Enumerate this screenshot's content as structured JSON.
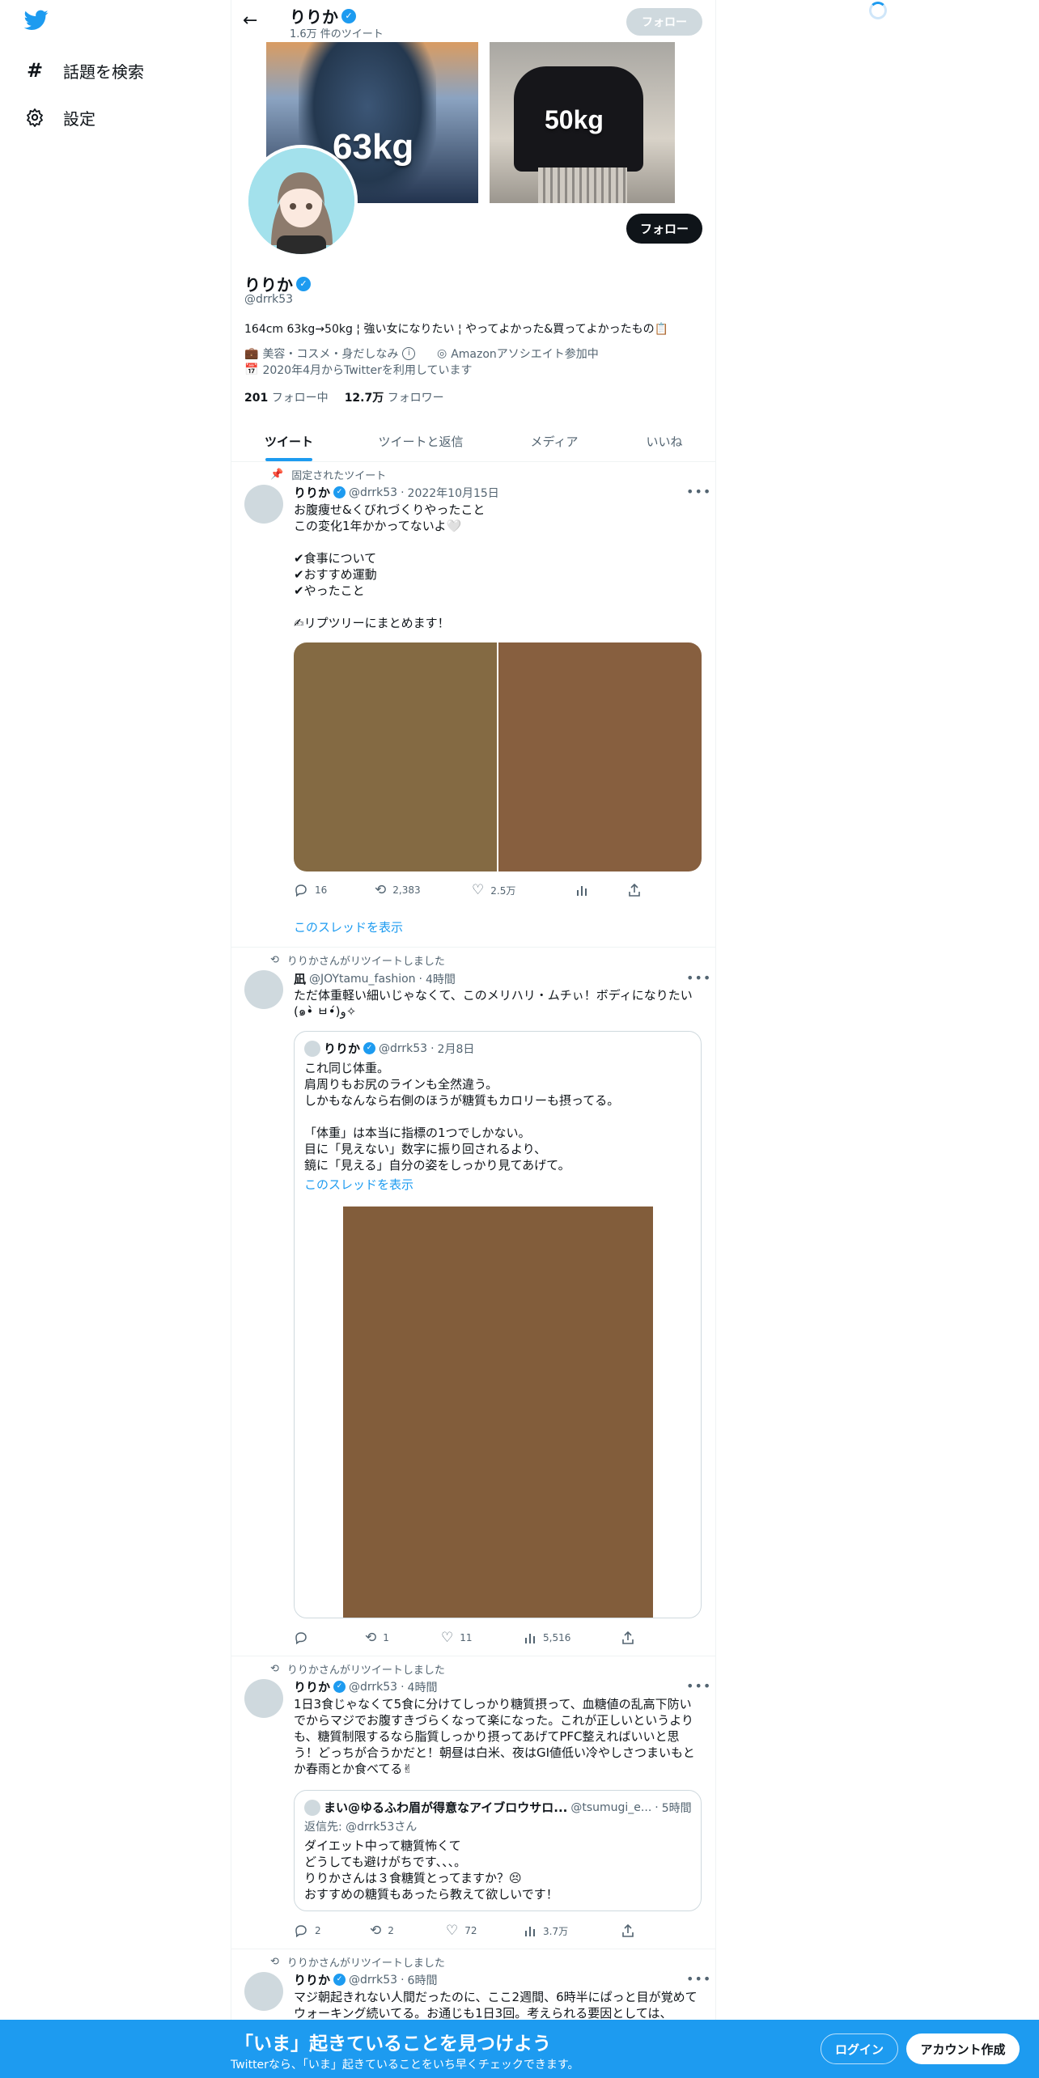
{
  "nav": {
    "explore_label": "話題を検索",
    "settings_label": "設定"
  },
  "header": {
    "name": "りりか",
    "tweet_count": "1.6万 件のツイート",
    "follow_label": "フォロー"
  },
  "banner": {
    "left_text": "63kg",
    "right_text": "50kg"
  },
  "profile": {
    "name": "りりか",
    "handle": "@drrk53",
    "follow_label": "フォロー",
    "bio": "164cm 63kg→50kg ¦ 強い女になりたい ¦ やってよかった&買ってよかったもの📋",
    "category": "美容・コスメ・身だしなみ",
    "website": "Amazonアソシエイト参加中",
    "joined": "2020年4月からTwitterを利用しています",
    "following_count": "201",
    "following_label": "フォロー中",
    "followers_count": "12.7万",
    "followers_label": "フォロワー"
  },
  "tabs": [
    "ツイート",
    "ツイートと返信",
    "メディア",
    "いいね"
  ],
  "tweets": [
    {
      "social": "固定されたツイート",
      "name": "りりか",
      "handle": "@drrk53",
      "time": "2022年10月15日",
      "text": "お腹痩せ&くびれづくりやったこと\nこの変化1年かかってないよ🤍\n\n✔食事について\n✔おすすめ運動\n✔やったこと\n\n✍リプツリーにまとめます！",
      "replies": "16",
      "retweets": "2,383",
      "likes": "2.5万",
      "thread_link": "このスレッドを表示",
      "media_colors": [
        "#846a43",
        "#875f3f"
      ]
    },
    {
      "social": "りりかさんがリツイートしました",
      "name": "凪",
      "handle": "@JOYtamu_fashion",
      "time": "4時間",
      "text": "ただ体重軽い細いじゃなくて、このメリハリ・ムチぃ！ボディになりたい(๑•̀ ㅂ•́)و✧",
      "quote": {
        "name": "りりか",
        "handle": "@drrk53",
        "time": "2月8日",
        "text": "これ同じ体重。\n肩周りもお尻のラインも全然違う。\nしかもなんなら右側のほうが糖質もカロリーも摂ってる。\n\n「体重」は本当に指標の1つでしかない。\n目に「見えない」数字に振り回されるより、\n鏡に「見える」自分の姿をしっかり見てあげて。",
        "thread_link": "このスレッドを表示",
        "media_color": "#825d3b"
      },
      "replies": "",
      "retweets": "1",
      "likes": "11",
      "views": "5,516"
    },
    {
      "social": "りりかさんがリツイートしました",
      "name": "りりか",
      "handle": "@drrk53",
      "time": "4時間",
      "text": "1日3食じゃなくて5食に分けてしっかり糖質摂って、血糖値の乱高下防いでからマジでお腹すきづらくなって楽になった。これが正しいというよりも、糖質制限するなら脂質しっかり摂ってあげてPFC整えればいいと思う！どっちが合うかだと！朝昼は白米、夜はGI値低い冷やしさつまいもとか春雨とか食べてる✌",
      "quote": {
        "name": "まい@ゆるふわ眉が得意なアイブロウサロ...",
        "handle": "@tsumugi_e...",
        "time": "5時間",
        "reply_to": "返信先: @drrk53さん",
        "text": "ダイエット中って糖質怖くて\nどうしても避けがちです、、、。\nりりかさんは３食糖質とってますか？😣\nおすすめの糖質もあったら教えて欲しいです！"
      },
      "replies": "2",
      "retweets": "2",
      "likes": "72",
      "views": "3.7万"
    },
    {
      "social": "りりかさんがリツイートしました",
      "name": "りりか",
      "handle": "@drrk53",
      "time": "6時間",
      "text": "マジ朝起きれない人間だったのに、ここ2週間、6時半にぱっと目が覚めてウォーキング続いてる。お通じも1日3回。考えられる要因としては、"
    }
  ],
  "bottom": {
    "headline": "「いま」起きていることを見つけよう",
    "sub": "Twitterなら、「いま」起きていることをいち早くチェックできます。",
    "login_label": "ログイン",
    "signup_label": "アカウント作成"
  },
  "colors": {
    "accent": "#1d9bf0",
    "bottom_bar": "#1d9bf0"
  }
}
